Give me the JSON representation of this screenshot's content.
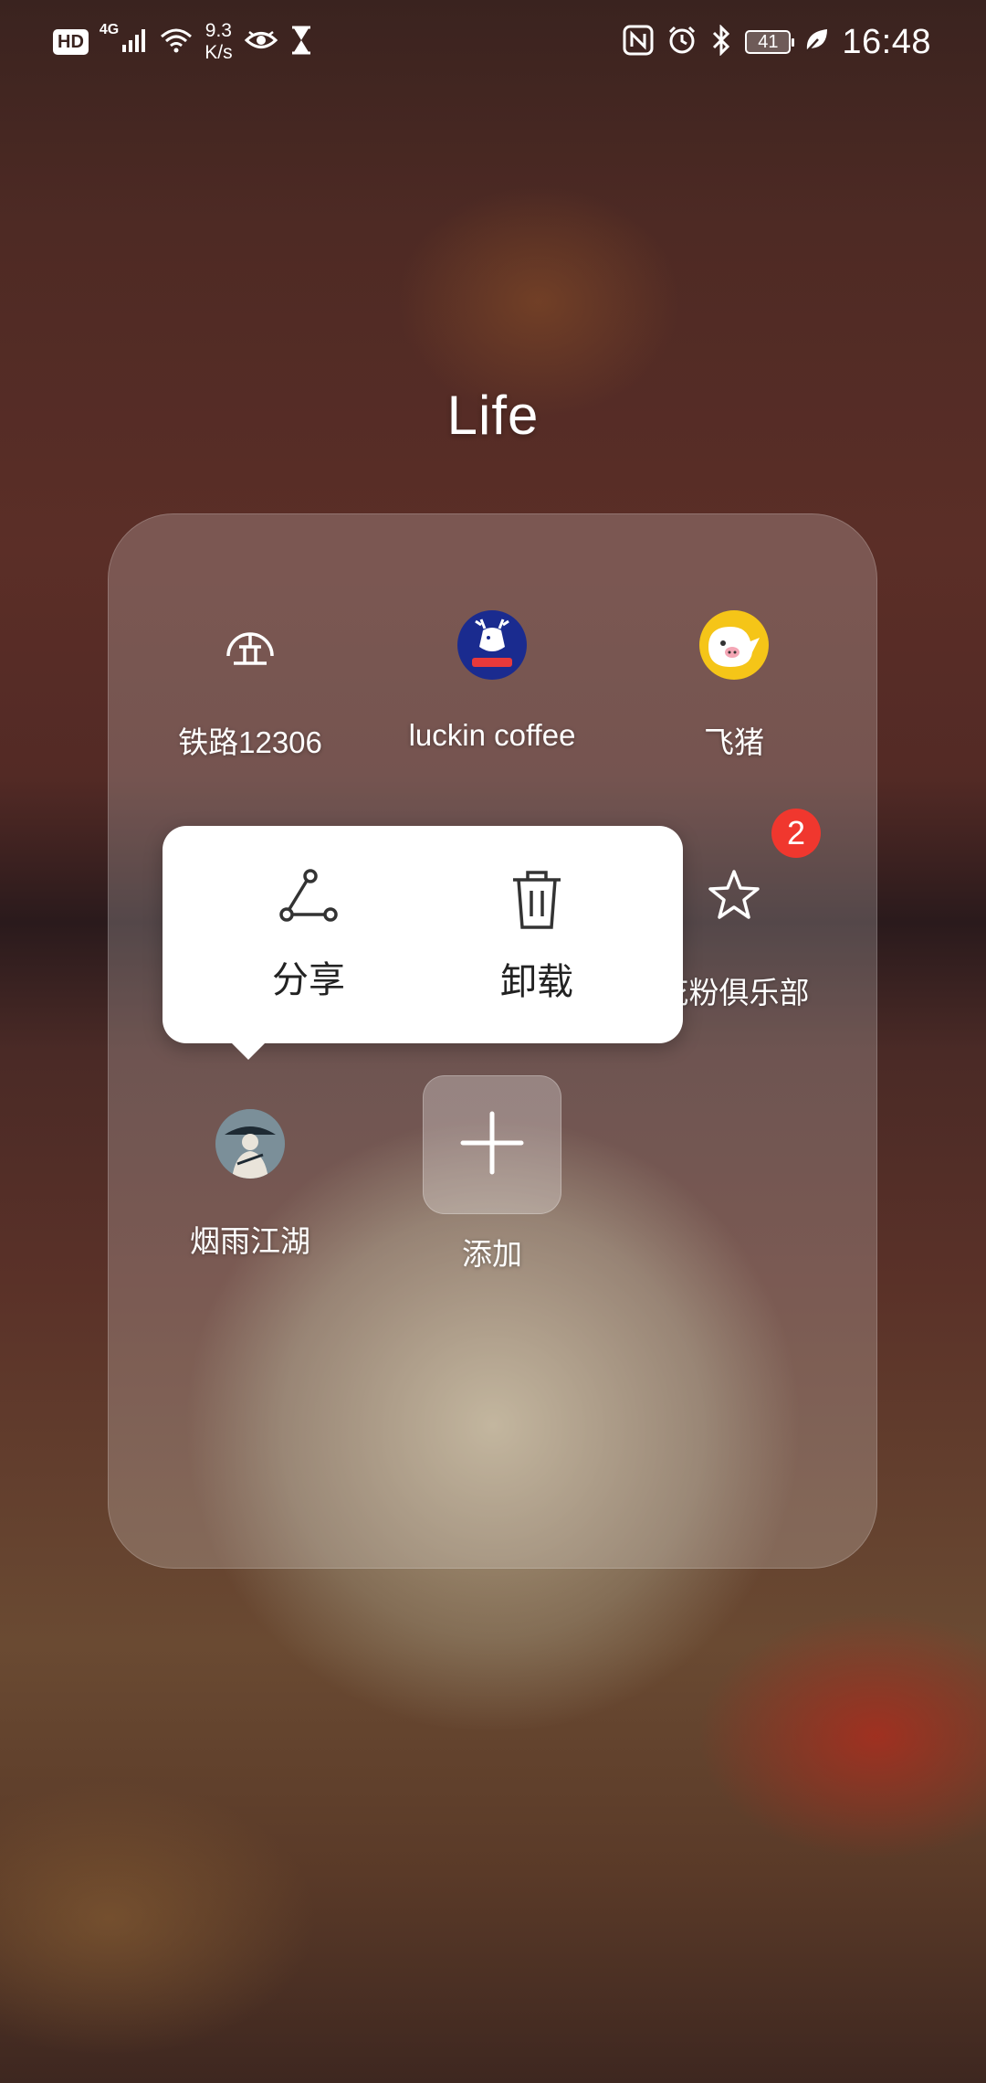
{
  "status_bar": {
    "hd": "HD",
    "network": "4G",
    "speed_value": "9.3",
    "speed_unit": "K/s",
    "battery": "41",
    "time": "16:48",
    "icons": [
      "signal-icon",
      "wifi-icon",
      "eye-icon",
      "hourglass-icon",
      "nfc-icon",
      "alarm-icon",
      "bluetooth-icon",
      "battery-icon",
      "leaf-icon"
    ]
  },
  "folder": {
    "title": "Life",
    "apps": [
      {
        "label": "铁路12306",
        "icon": "railway-icon"
      },
      {
        "label": "luckin coffee",
        "icon": "luckin-deer-icon"
      },
      {
        "label": "飞猪",
        "icon": "fliggy-pig-icon"
      },
      {
        "label": "花粉俱乐部",
        "icon": "star-icon",
        "badge": "2"
      },
      {
        "label": "烟雨江湖",
        "icon": "game-avatar-icon"
      },
      {
        "label": "添加",
        "icon": "plus-icon"
      }
    ]
  },
  "context_menu": {
    "share_label": "分享",
    "uninstall_label": "卸载"
  },
  "colors": {
    "badge": "#f0372e",
    "luckin_blue": "#1a2b8f",
    "fliggy_yellow": "#f5c518"
  }
}
